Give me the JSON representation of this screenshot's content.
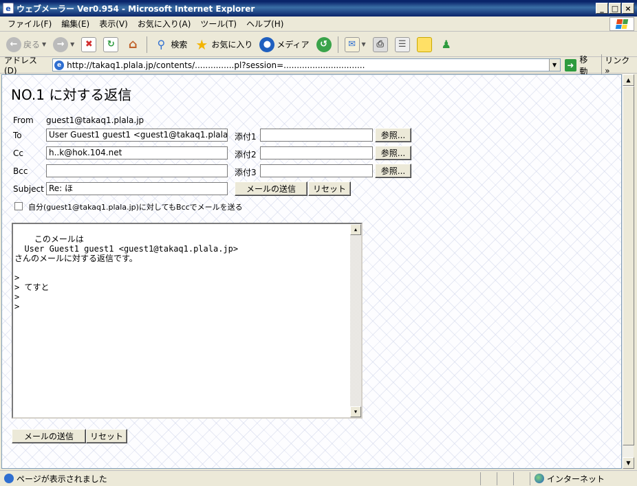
{
  "window": {
    "title": "ウェブメーラー Ver0.954 - Microsoft Internet Explorer",
    "minimize": "_",
    "maximize": "□",
    "close": "×"
  },
  "menu": [
    "ファイル(F)",
    "編集(E)",
    "表示(V)",
    "お気に入り(A)",
    "ツール(T)",
    "ヘルプ(H)"
  ],
  "toolbar": {
    "back": "戻る",
    "search": "検索",
    "favorites": "お気に入り",
    "media": "メディア"
  },
  "address": {
    "label": "アドレス(D)",
    "url": "http://takaq1.plala.jp/contents/...............pl?session=...............................",
    "go": "移動",
    "links": "リンク"
  },
  "form": {
    "title": "NO.1 に対する返信",
    "from_label": "From",
    "from_value": "guest1@takaq1.plala.jp",
    "to_label": "To",
    "to_value": "User Guest1 guest1 <guest1@takaq1.plala.jp>",
    "cc_label": "Cc",
    "cc_value": "h..k@hok.104.net",
    "bcc_label": "Bcc",
    "bcc_value": "",
    "subject_label": "Subject",
    "subject_value": "Re: ほ",
    "attach1_label": "添付1",
    "attach2_label": "添付2",
    "attach3_label": "添付3",
    "browse": "参照...",
    "send": "メールの送信",
    "reset": "リセット",
    "bcc_self_label": "自分(guest1@takaq1.plala.jp)に対してもBccでメールを送る",
    "body": "このメールは\n  User Guest1 guest1 <guest1@takaq1.plala.jp>\nさんのメールに対する返信です。\n\n>\n> てすと\n>\n>"
  },
  "footer": {
    "link": "..........................."
  },
  "status": {
    "text": "ページが表示されました",
    "zone": "インターネット"
  }
}
